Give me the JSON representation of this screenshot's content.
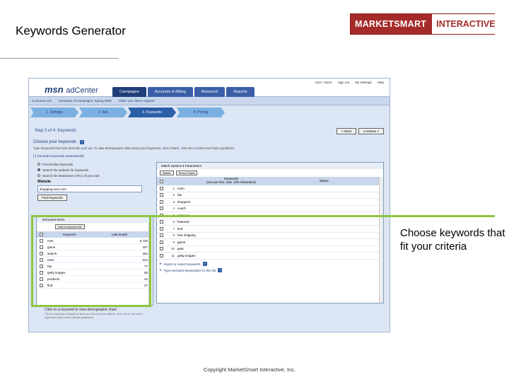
{
  "slide": {
    "title": "Keywords Generator",
    "callout": "Choose keywords that fit your criteria",
    "copyright": "Copyright MarketSmart Interactive, Inc."
  },
  "logo": {
    "left": "MARKETSMART",
    "right": "INTERACTIVE"
  },
  "app": {
    "logo_msn": "msn",
    "logo_ad": "adCenter",
    "tabs": [
      "Campaigns",
      "Accounts & Billing",
      "Research",
      "Reports"
    ],
    "user_links": [
      "User: User1",
      "Sign out",
      "My Settings",
      "Help"
    ],
    "breadcrumb": [
      "Customer List",
      "Summary of Campaigns: Spring 2006",
      "Order List: Men's Apparel"
    ],
    "steps": [
      "1. Settings",
      "2. Ads",
      "3. Keywords",
      "4. Pricing"
    ],
    "step_label": "Step 3 of 4:  Keywords",
    "back_button": "< Back",
    "continue_button": "Continue >",
    "section_title": "Choose your keywords",
    "section_desc": "Type keywords that best describe your ad. To view demographic data about your keywords, click Charts. View the Content and Style guidelines",
    "generate_link": "[-]  Generate keywords automatically",
    "radio_options": [
      "Find similar keywords",
      "Search the website for keywords",
      "Search the destination URLs of your ads"
    ],
    "website_label": "Website",
    "website_value": "shopping.msn.com",
    "find_button": "Find Keywords",
    "extracted": {
      "title": "Extracted terms",
      "add_button": "Add to keyword list",
      "col_keyword": "Keyword",
      "col_last_month": "Last month",
      "rows": [
        {
          "keyword": "msn",
          "value": "6,720"
        },
        {
          "keyword": "game",
          "value": "447"
        },
        {
          "keyword": "search",
          "value": "264"
        },
        {
          "keyword": "even",
          "value": "224"
        },
        {
          "keyword": "hip",
          "value": "77"
        },
        {
          "keyword": "getty images",
          "value": "56"
        },
        {
          "keyword": "products",
          "value": "42"
        },
        {
          "keyword": "find",
          "value": "27"
        }
      ]
    },
    "click_note": "Click on a keyword to view demographic chart",
    "click_sub": "*Tip for keywords: Expand or limit your list to fit your criteria. Here, these are select keywords which meet editorial guidelines.",
    "right_panel": {
      "top_bar": "Match Options  ▾ Parameters",
      "btn_delete": "Delete",
      "btn_charts": "Show Charts",
      "col_keywords": "Keywords",
      "col_keywords_sub": "(one per line, max. 100 characters)",
      "col_status": "Status",
      "rows": [
        {
          "num": "1",
          "keyword": "even"
        },
        {
          "num": "2",
          "keyword": "hip"
        },
        {
          "num": "3",
          "keyword": "shoppers"
        },
        {
          "num": "4",
          "keyword": "coach"
        },
        {
          "num": "5",
          "keyword": "compare"
        },
        {
          "num": "6",
          "keyword": "featured"
        },
        {
          "num": "7",
          "keyword": "find"
        },
        {
          "num": "8",
          "keyword": "free shipping"
        },
        {
          "num": "9",
          "keyword": "game"
        },
        {
          "num": "10",
          "keyword": "gear"
        },
        {
          "num": "11",
          "keyword": "getty images"
        }
      ],
      "link_import": "Import or export keywords",
      "link_type": "Type excluded keyword(s) for this list"
    }
  }
}
